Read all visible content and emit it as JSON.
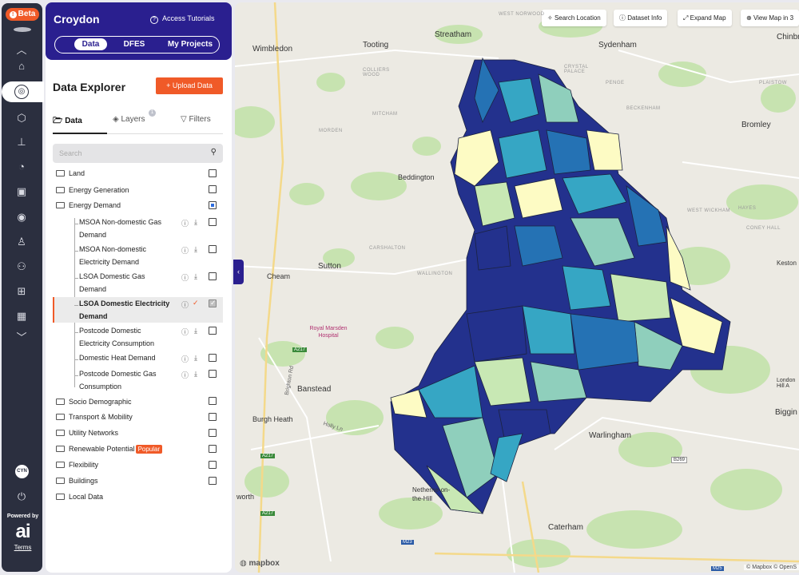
{
  "rail": {
    "beta_label": "Beta",
    "icons": [
      "chevron-up-icon",
      "home-icon",
      "location-pin-icon",
      "box-icon",
      "hierarchy-icon",
      "gauge-icon",
      "calendar-icon",
      "target-icon",
      "person-icon",
      "group-icon",
      "network-icon",
      "building-icon",
      "chevron-down-icon"
    ],
    "avatar": "CYN",
    "powered_by": "Powered by",
    "brand": "ai",
    "terms": "Terms"
  },
  "header": {
    "title": "Croydon",
    "tutorials": "Access Tutorials",
    "tabs": [
      "Data",
      "DFES",
      "My Projects"
    ],
    "active_tab": "Data"
  },
  "explorer": {
    "title": "Data Explorer",
    "upload_label": "Upload Data",
    "tabs": {
      "data": "Data",
      "layers": "Layers",
      "layers_badge": "1",
      "filters": "Filters"
    },
    "search_placeholder": "Search"
  },
  "tree": {
    "land": "Land",
    "energy_generation": "Energy Generation",
    "energy_demand": "Energy Demand",
    "children": [
      "MSOA Non-domestic Gas Demand",
      "MSOA Non-domestic Electricity Demand",
      "LSOA Domestic Gas Demand",
      "LSOA Domestic Electricity Demand",
      "Postcode Domestic Electricity Consumption",
      "Domestic Heat Demand",
      "Postcode Domestic Gas Consumption"
    ],
    "socio": "Socio Demographic",
    "transport": "Transport & Mobility",
    "utility": "Utility Networks",
    "renewable": "Renewable Potential",
    "popular": "Popular",
    "flexibility": "Flexibility",
    "buildings": "Buildings",
    "local": "Local Data"
  },
  "map": {
    "buttons": [
      "Search Location",
      "Dataset Info",
      "Expand Map",
      "View Map in 3"
    ],
    "places": {
      "streatham": "Streatham",
      "sydenham": "Sydenham",
      "wimbledon": "Wimbledon",
      "tooting": "Tooting",
      "bromley": "Bromley",
      "beddington": "Beddington",
      "sutton": "Sutton",
      "cheam": "Cheam",
      "carshalton": "CARSHALTON",
      "wallington": "WALLINGTON",
      "banstead": "Banstead",
      "burgh_heath": "Burgh Heath",
      "warlingham": "Warlingham",
      "caterham": "Caterham",
      "netherne": "Netherne-on-the-Hill",
      "keston": "Keston",
      "biggin": "Biggin",
      "chinbr": "Chinbr",
      "royal_marsden": "Royal Marsden Hospital",
      "west_norwood": "WEST NORWOOD",
      "penge": "PENGE",
      "beckenham": "BECKENHAM",
      "plaistow": "PLAISTOW",
      "west_wickham": "WEST WICKHAM",
      "hayes": "HAYES",
      "coney_hall": "CONEY HALL",
      "morden": "MORDEN",
      "mitcham": "MITCHAM",
      "colliers_wood": "COLLIERS WOOD",
      "crystal_palace": "CRYSTAL PALACE",
      "worth": "worth",
      "london_hill": "London Hill A"
    },
    "roads": [
      "A217",
      "A217",
      "A217",
      "B269",
      "M23",
      "M25"
    ],
    "road_names": {
      "brighton_rd": "Brighton Rd",
      "holly_ln": "Holly Ln"
    },
    "mapbox_logo": "mapbox",
    "attribution": "© Mapbox © OpenS",
    "choropleth_colors": [
      "#23318d",
      "#2572b4",
      "#36a6c4",
      "#8fcfbc",
      "#c8e8b4",
      "#fdfbc4"
    ]
  }
}
